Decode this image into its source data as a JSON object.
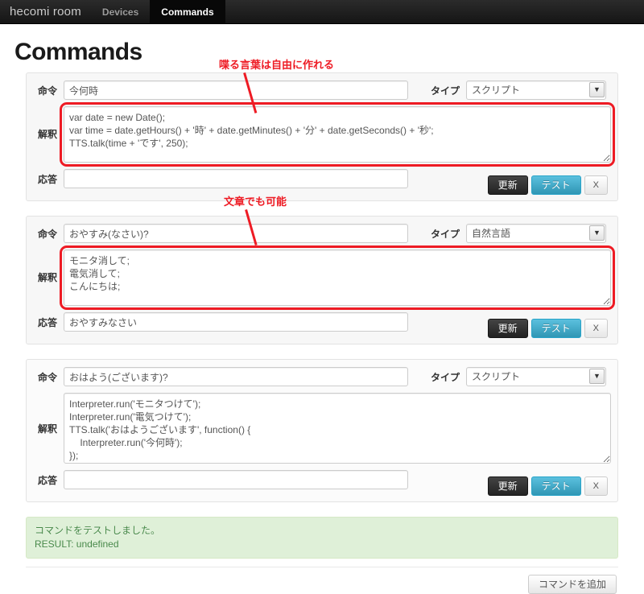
{
  "navbar": {
    "brand": "hecomi room",
    "items": [
      {
        "label": "Devices",
        "active": false
      },
      {
        "label": "Commands",
        "active": true
      }
    ]
  },
  "page": {
    "title": "Commands"
  },
  "labels": {
    "command": "命令",
    "interpretation": "解釈",
    "response": "応答",
    "type": "タイプ",
    "select_arrow": "▼"
  },
  "buttons": {
    "update": "更新",
    "test": "テスト",
    "delete": "X",
    "add_command": "コマンドを追加"
  },
  "annotations": [
    {
      "text": "喋る言葉は自由に作れる"
    },
    {
      "text": "文章でも可能"
    }
  ],
  "commands": [
    {
      "command": "今何時",
      "type": "スクリプト",
      "interpretation": "var date = new Date();\nvar time = date.getHours() + '時' + date.getMinutes() + '分' + date.getSeconds() + '秒';\nTTS.talk(time + 'です', 250);",
      "response": ""
    },
    {
      "command": "おやすみ(なさい)?",
      "type": "自然言語",
      "interpretation": "モニタ消して;\n電気消して;\nこんにちは;",
      "response": "おやすみなさい"
    },
    {
      "command": "おはよう(ございます)?",
      "type": "スクリプト",
      "interpretation": "Interpreter.run('モニタつけて');\nInterpreter.run('電気つけて');\nTTS.talk('おはようございます', function() {\n    Interpreter.run('今何時');\n});",
      "response": ""
    }
  ],
  "alert": {
    "line1": "コマンドをテストしました。",
    "line2": "RESULT: undefined"
  },
  "colors": {
    "annotation_red": "#ee1b24",
    "test_button_blue": "#2f96b4",
    "alert_green_bg": "#dff0d8",
    "alert_green_text": "#468847",
    "navbar_dark": "#151515"
  }
}
